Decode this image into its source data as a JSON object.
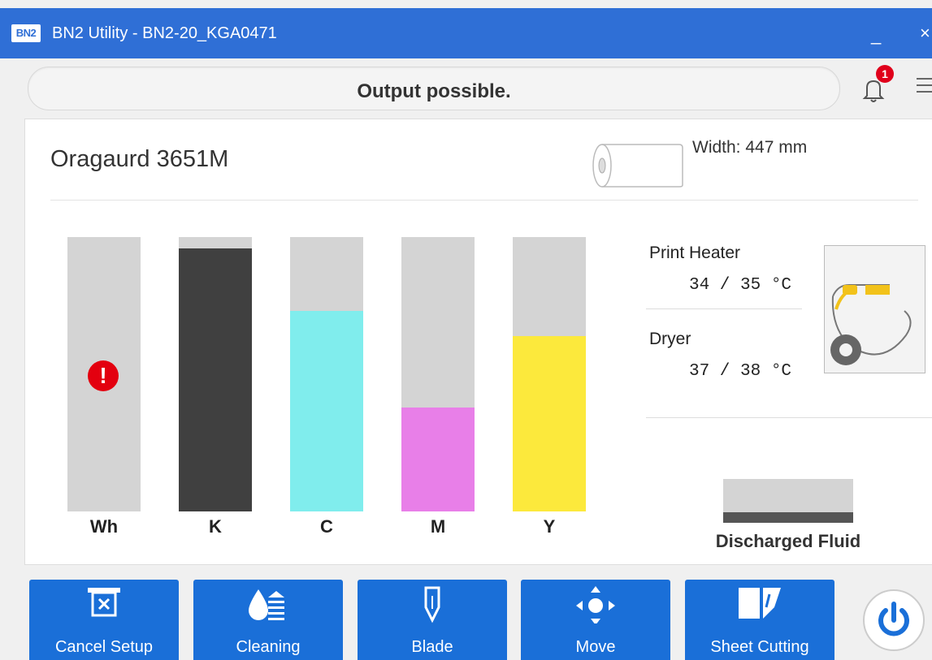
{
  "window": {
    "logo_text": "BN2",
    "title": "BN2 Utility - BN2-20_KGA0471",
    "minimize_glyph": "_",
    "close_glyph": "×"
  },
  "status": {
    "message": "Output possible.",
    "notification_count": "1"
  },
  "media": {
    "name": "Oragaurd 3651M",
    "width_text": "Width: 447 mm"
  },
  "inks": [
    {
      "label": "Wh",
      "level": 0.0,
      "color": "#ffffff",
      "warning": true
    },
    {
      "label": "K",
      "level": 0.96,
      "color": "#404040",
      "warning": false
    },
    {
      "label": "C",
      "level": 0.73,
      "color": "#80eded",
      "warning": false
    },
    {
      "label": "M",
      "level": 0.38,
      "color": "#e87fe8",
      "warning": false
    },
    {
      "label": "Y",
      "level": 0.64,
      "color": "#fce93c",
      "warning": false
    }
  ],
  "heaters": {
    "print_label": "Print Heater",
    "print_value": "34 / 35 °C",
    "dryer_label": "Dryer",
    "dryer_value": "37 / 38 °C"
  },
  "discharged_fluid": {
    "label": "Discharged Fluid",
    "level": 0.24
  },
  "buttons": [
    {
      "label": "Cancel Setup",
      "icon": "cancel-setup-icon"
    },
    {
      "label": "Cleaning",
      "icon": "cleaning-icon"
    },
    {
      "label": "Blade",
      "icon": "blade-icon"
    },
    {
      "label": "Move",
      "icon": "move-icon"
    },
    {
      "label": "Sheet Cutting",
      "icon": "sheet-cutting-icon"
    }
  ],
  "colors": {
    "titlebar": "#2f6fd6",
    "button": "#1a6fd8",
    "warning": "#e3000f",
    "heater_accent": "#f2c21a"
  }
}
